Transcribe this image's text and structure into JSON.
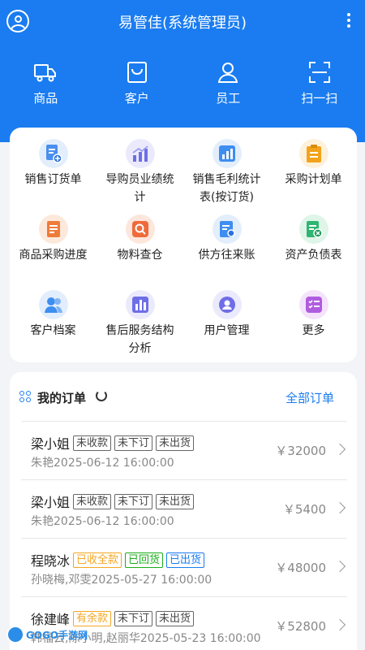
{
  "header": {
    "title": "易管佳(系统管理员)",
    "quick_actions": [
      {
        "label": "商品",
        "icon": "truck-icon"
      },
      {
        "label": "客户",
        "icon": "shopping-bag-icon"
      },
      {
        "label": "员工",
        "icon": "person-icon"
      },
      {
        "label": "扫一扫",
        "icon": "scan-icon"
      }
    ]
  },
  "menu": [
    {
      "label": "销售订货单",
      "icon": "order-add-icon",
      "color": "#4a8ff0"
    },
    {
      "label": "导购员业绩统计",
      "icon": "bar-chart-trend-icon",
      "color": "#6e6ee6"
    },
    {
      "label": "销售毛利统计表(按订货)",
      "icon": "bar-chart-icon",
      "color": "#3d8ef0"
    },
    {
      "label": "采购计划单",
      "icon": "clipboard-icon",
      "color": "#f2a31b"
    },
    {
      "label": "商品采购进度",
      "icon": "document-icon",
      "color": "#ef7b3a"
    },
    {
      "label": "物料查仓",
      "icon": "search-icon",
      "color": "#f06a3a"
    },
    {
      "label": "供方往来账",
      "icon": "ledger-icon",
      "color": "#3d8ef0"
    },
    {
      "label": "资产负债表",
      "icon": "balance-sheet-icon",
      "color": "#2fb571"
    },
    {
      "label": "客户档案",
      "icon": "customers-icon",
      "color": "#3d8ef0"
    },
    {
      "label": "售后服务结构分析",
      "icon": "bar-analysis-icon",
      "color": "#6e6ee6"
    },
    {
      "label": "用户管理",
      "icon": "user-search-icon",
      "color": "#6e6ee6"
    },
    {
      "label": "更多",
      "icon": "more-list-icon",
      "color": "#b05ce0"
    }
  ],
  "orders": {
    "title": "我的订单",
    "all_label": "全部订单",
    "items": [
      {
        "name": "梁小姐",
        "tags": [
          {
            "text": "未收款",
            "style": "gray"
          },
          {
            "text": "未下订",
            "style": "gray"
          },
          {
            "text": "未出货",
            "style": "gray"
          }
        ],
        "sub": "朱艳2025-06-12 16:00:00",
        "amount": "￥32000"
      },
      {
        "name": "梁小姐",
        "tags": [
          {
            "text": "未收款",
            "style": "gray"
          },
          {
            "text": "未下订",
            "style": "gray"
          },
          {
            "text": "未出货",
            "style": "gray"
          }
        ],
        "sub": "朱艳2025-06-12 16:00:00",
        "amount": "￥5400"
      },
      {
        "name": "程晓冰",
        "tags": [
          {
            "text": "已收全款",
            "style": "orange"
          },
          {
            "text": "已回货",
            "style": "green"
          },
          {
            "text": "已出货",
            "style": "blue"
          }
        ],
        "sub": "孙晓梅,邓雯2025-05-27 16:00:00",
        "amount": "￥48000"
      },
      {
        "name": "徐建峰",
        "tags": [
          {
            "text": "有余款",
            "style": "orange"
          },
          {
            "text": "未下订",
            "style": "gray"
          },
          {
            "text": "未出货",
            "style": "gray"
          }
        ],
        "sub": "韩福云,陈小明,赵丽华2025-05-23 16:00:00",
        "amount": "￥52800"
      }
    ]
  },
  "watermark": "GOGO手游网"
}
